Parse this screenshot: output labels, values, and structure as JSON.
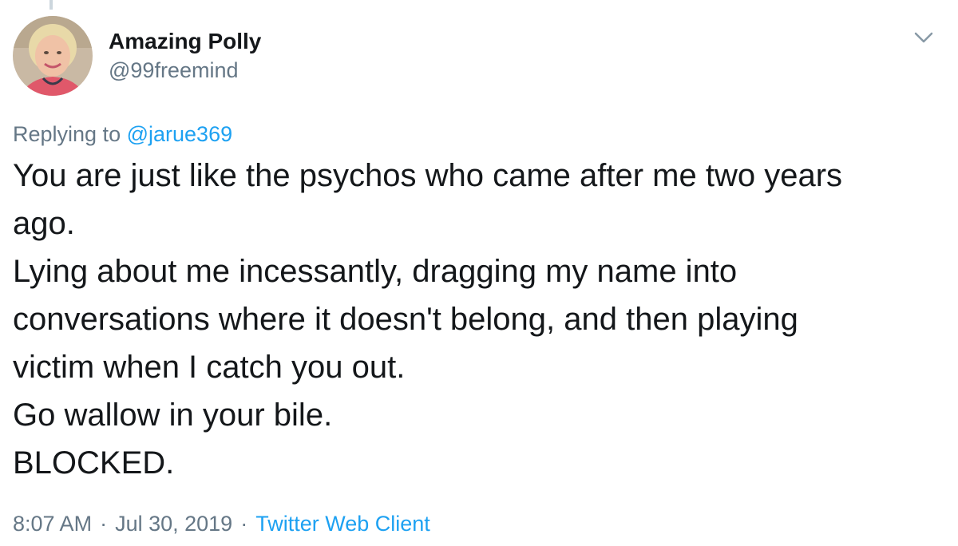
{
  "tweet": {
    "author": {
      "display_name": "Amazing Polly",
      "handle": "@99freemind",
      "avatar_icon": "profile-photo"
    },
    "menu_icon": "chevron-down-icon",
    "reply": {
      "prefix": "Replying to",
      "handle": "@jarue369"
    },
    "text_lines": [
      "You are just like the psychos who came after me two years",
      "ago.",
      "Lying about me incessantly, dragging my name into",
      "conversations where it doesn't belong, and then playing",
      "victim when I catch you out.",
      "Go wallow in your bile.",
      "BLOCKED."
    ],
    "time": "8:07 AM",
    "separator": "·",
    "date": "Jul 30, 2019",
    "client": "Twitter Web Client"
  },
  "colors": {
    "text": "#14171a",
    "secondary": "#657786",
    "link": "#1da1f2",
    "thread_line": "#ccd6dd"
  }
}
